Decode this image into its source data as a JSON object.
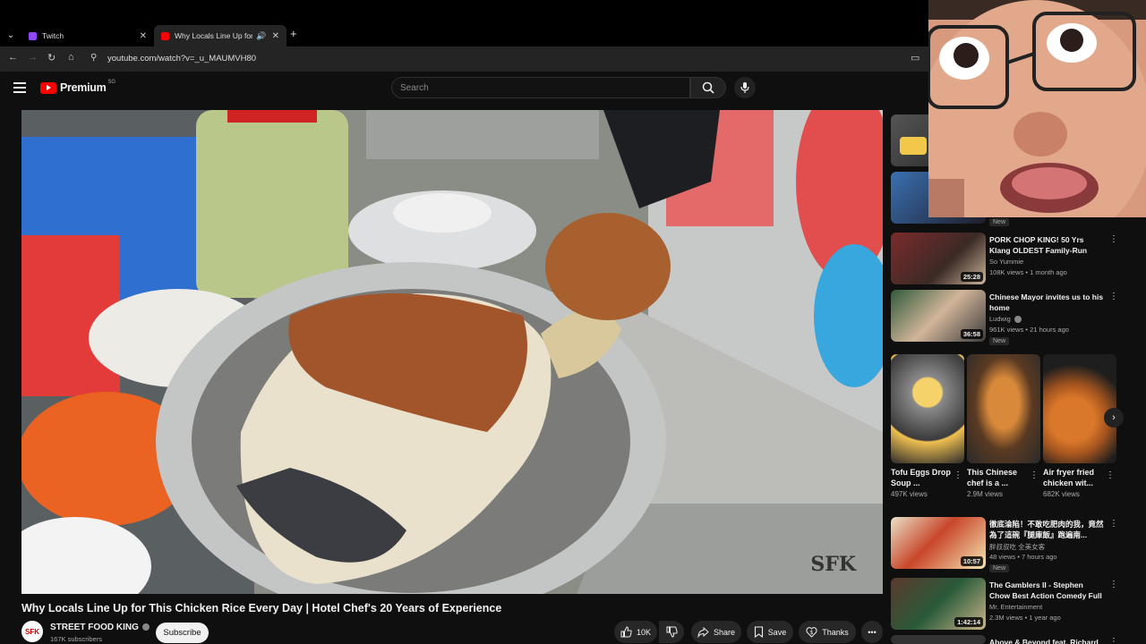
{
  "browser": {
    "tabs": [
      {
        "title": "Twitch",
        "color": "#9146ff"
      },
      {
        "title": "Why Locals Line Up for This Chicken Rice",
        "color": "#ff0000"
      }
    ],
    "url": "youtube.com/watch?v=_u_MAUMVH80"
  },
  "youtube": {
    "logo": "Premium",
    "logo_badge": "SG",
    "search_placeholder": "Search"
  },
  "video": {
    "title": "Why Locals Line Up for This Chicken Rice Every Day | Hotel Chef's 20 Years of Experience",
    "channel": "STREET FOOD KING",
    "channel_avatar": "SFK",
    "subscribers": "167K subscribers",
    "subscribe_label": "Subscribe",
    "likes": "10K",
    "share_label": "Share",
    "save_label": "Save",
    "thanks_label": "Thanks",
    "watermark": "SFK"
  },
  "recommendations": [
    {
      "title": "",
      "channel": "",
      "meta": "",
      "badge": "New",
      "duration": ""
    },
    {
      "title": "PORK CHOP KING! 50 Yrs Klang OLDEST Family-Run PORK ...",
      "channel": "So Yummie",
      "meta": "108K views • 1 month ago",
      "badge": "",
      "duration": "25:28"
    },
    {
      "title": "Chinese Mayor invites us to his home",
      "channel": "Ludwig",
      "meta": "961K views • 21 hours ago",
      "badge": "New",
      "duration": "36:58"
    }
  ],
  "shorts": [
    {
      "title": "Tofu Eggs Drop Soup ...",
      "views": "497K views"
    },
    {
      "title": "This Chinese chef is a ...",
      "views": "2.9M views"
    },
    {
      "title": "Air fryer fried chicken wit...",
      "views": "682K views"
    }
  ],
  "recommendations2": [
    {
      "title": "徹底淪陷！不敢吃肥肉的我，竟然為了這碗『腿庫飯』跑遍南...",
      "channel": "胖叔叔吃 全美女客",
      "meta": "48 views • 7 hours ago",
      "badge": "New",
      "duration": "10:57"
    },
    {
      "title": "The Gamblers II - Stephen Chow Best Action Comedy Full Movi...",
      "channel": "Mr. Entertainment",
      "meta": "2.3M views • 1 year ago",
      "badge": "",
      "duration": "1:42:14"
    },
    {
      "title": "Above & Beyond feat. Richard",
      "channel": "",
      "meta": "",
      "badge": "",
      "duration": ""
    }
  ]
}
